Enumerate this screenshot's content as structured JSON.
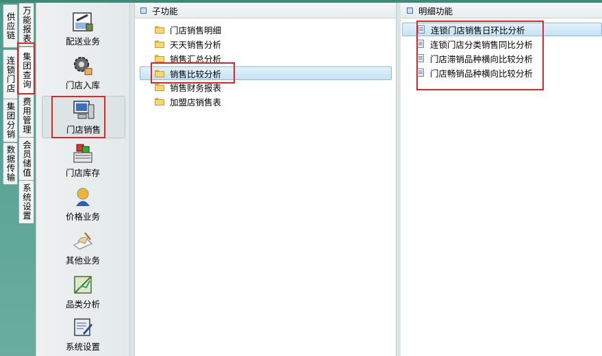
{
  "tabs_col1": [
    "供应链",
    "连锁门店",
    "集团分销",
    "数据传输"
  ],
  "tabs_col2": [
    "万能报表",
    "集团查询",
    "费用管理",
    "会员储值",
    "系统设置"
  ],
  "icon_menu": [
    {
      "label": "配送业务",
      "icon": "delivery-icon"
    },
    {
      "label": "门店入库",
      "icon": "gear-icon"
    },
    {
      "label": "门店销售",
      "icon": "computer-icon"
    },
    {
      "label": "门店库存",
      "icon": "inventory-icon"
    },
    {
      "label": "价格业务",
      "icon": "user-icon"
    },
    {
      "label": "其他业务",
      "icon": "hand-writing-icon"
    },
    {
      "label": "品类分析",
      "icon": "chart-icon"
    },
    {
      "label": "系统设置",
      "icon": "settings-pen-icon"
    }
  ],
  "sub_panel": {
    "title": "子功能",
    "items": [
      "门店销售明细",
      "天天销售分析",
      "销售汇总分析",
      "销售比较分析",
      "销售财务报表",
      "加盟店销售表"
    ],
    "selected_index": 3
  },
  "detail_panel": {
    "title": "明细功能",
    "items": [
      "连锁门店销售日环比分析",
      "连锁门店分类销售同比分析",
      "门店滞销品种横向比较分析",
      "门店畅销品种横向比较分析"
    ],
    "selected_index": 0
  },
  "colors": {
    "frame": "#4f9b8a",
    "highlight": "#c6e2f6",
    "annotation": "#e02424"
  }
}
